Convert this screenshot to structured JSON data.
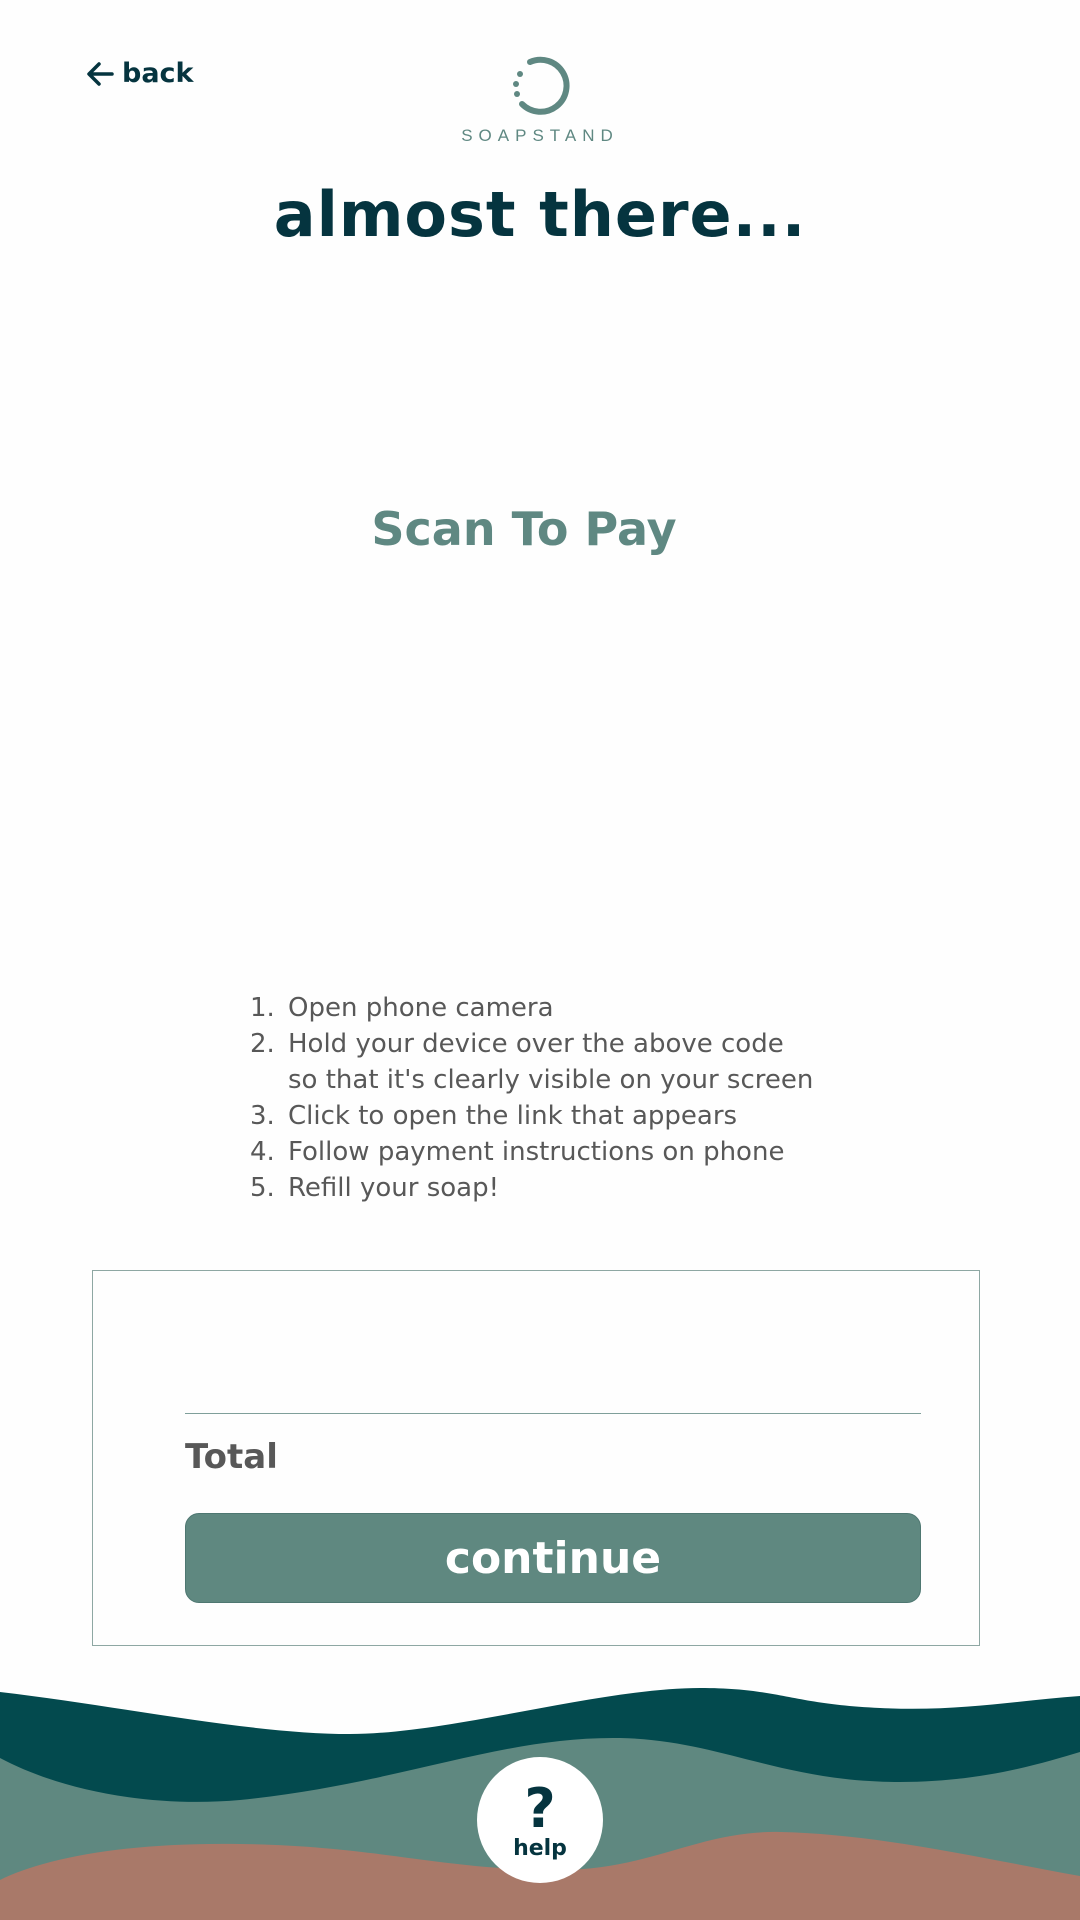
{
  "header": {
    "back_label": "back",
    "brand_name": "SOAPSTAND",
    "title": "almost there..."
  },
  "payment": {
    "scan_heading": "Scan To Pay",
    "steps": [
      {
        "number": "1.",
        "text": "Open phone camera"
      },
      {
        "number": "2.",
        "text": "Hold your device over the above code"
      },
      {
        "number": "",
        "text": "so that it's clearly visible on your screen"
      },
      {
        "number": "3.",
        "text": "Click to open the link that appears"
      },
      {
        "number": "4.",
        "text": "Follow payment instructions on phone"
      },
      {
        "number": "5.",
        "text": "Refill your soap!"
      }
    ]
  },
  "summary": {
    "total_label": "Total",
    "continue_label": "continue"
  },
  "help": {
    "icon_glyph": "?",
    "label": "help"
  },
  "colors": {
    "dark_teal": "#05343f",
    "sage": "#5f8880",
    "wave_dark": "#034a4e",
    "wave_terracotta": "#a97969",
    "text_gray": "#585858"
  },
  "icons": [
    "arrow-left-icon",
    "soapstand-logo-icon",
    "question-mark-icon"
  ]
}
